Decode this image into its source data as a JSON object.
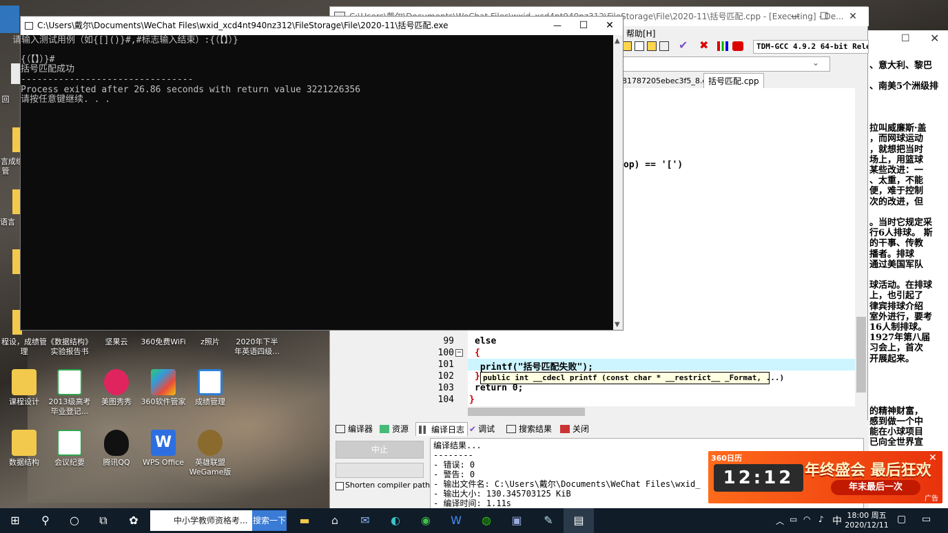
{
  "console": {
    "title": "C:\\Users\\戴尔\\Documents\\WeChat Files\\wxid_xcd4nt940nz312\\FileStorage\\File\\2020-11\\括号匹配.exe",
    "lines": [
      "请输入测试用例（如{[]()}#,#标志输入结束）:{（【】）}",
      "",
      "{（【】）}#",
      "括号匹配成功",
      "--------------------------------",
      "Process exited after 26.86 seconds with return value 3221226356",
      "请按任意键继续. . ."
    ],
    "minimize": "—",
    "maximize": "☐",
    "close": "✕"
  },
  "devcpp": {
    "title": "C:\\Users\\戴尔\\Documents\\WeChat Files\\wxid_xcd4nt940nz312\\FileStorage\\File\\2020-11\\括号匹配.cpp - [Executing] - De...",
    "menu_help": "帮助[H]",
    "compiler": "TDM-GCC 4.9.2 64-bit Release",
    "tab_prev": "81787205ebec3f5_8.cpp",
    "tab_active": "括号匹配.cpp",
    "code_fragment": "op) == '[')",
    "lines": [
      {
        "n": "99",
        "code": "else"
      },
      {
        "n": "100",
        "code": "{"
      },
      {
        "n": "101",
        "code": " printf(\"括号匹配失败\");"
      },
      {
        "n": "102",
        "code": "}"
      },
      {
        "n": "103",
        "code": "return 0;"
      },
      {
        "n": "104",
        "code": "}"
      }
    ],
    "tooltip": "public int __cdecl printf (const char * __restrict__ _Format, ...)",
    "bottom_tabs": [
      "编译器",
      "资源",
      "编译日志",
      "调试",
      "搜索结果",
      "关闭"
    ],
    "stop_button": "中止",
    "shorten_paths": "Shorten compiler paths",
    "log": [
      "编译结果...",
      "--------",
      "- 错误: 0",
      "- 警告: 0",
      "- 输出文件名: C:\\Users\\戴尔\\Documents\\WeChat Files\\wxid_",
      "- 输出大小: 130.345703125 KiB",
      "- 编译时间: 1.11s"
    ]
  },
  "doc": {
    "lines": [
      "、意大利、黎巴",
      "",
      "、南美5个洲级排",
      "",
      "",
      "",
      "拉叫威廉斯·盖",
      "，而网球运动",
      "，就想把当时",
      "场上，用篮球",
      "某些改进：一",
      "、太重，不能",
      "便，难于控制",
      "次的改进，但",
      "",
      "。当时它规定采",
      "行6人排球。 斯",
      "的干事、传教",
      "播者。排球",
      "通过美国军队",
      "",
      "球活动。在排球",
      "上，也引起了",
      "律宾排球介绍",
      "室外进行，要考",
      "16人制排球。",
      "1927年第八届",
      "习会上，首次",
      "开展起来。",
      "",
      "",
      "",
      "",
      "的精神财富，",
      "感到做一个中",
      "能在小球项目",
      "已向全世界宣"
    ]
  },
  "desktop_icons": [
    {
      "label": "程设，成绩管理"
    },
    {
      "label": "《数据结构》实验报告书"
    },
    {
      "label": "坚果云"
    },
    {
      "label": "360免费WiFi"
    },
    {
      "label": "z照片"
    },
    {
      "label": "2020年下半年英语四级..."
    },
    {
      "label": "课程设计"
    },
    {
      "label": "2013级高考毕业登记..."
    },
    {
      "label": "美图秀秀"
    },
    {
      "label": "360软件管家"
    },
    {
      "label": "成绩管理"
    },
    {
      "label": "数据结构"
    },
    {
      "label": "会议纪要"
    },
    {
      "label": "腾讯QQ"
    },
    {
      "label": "WPS Office"
    },
    {
      "label": "英雄联盟WeGame版"
    }
  ],
  "left_edge_labels": [
    "C语言成绩管",
    "c语言",
    "回"
  ],
  "ad": {
    "brand": "360日历",
    "clock": "12:12",
    "headline": "年终盛会 最后狂欢",
    "sub": "年末最后一次",
    "tag": "广告"
  },
  "taskbar": {
    "search_text": "中小学教师资格考...",
    "search_button": "搜索一下",
    "time": "18:00 周五",
    "date": "2020/12/11",
    "ime": "中"
  },
  "colors": {
    "accent": "#3a7bd5",
    "console_bg": "#0c0c0c",
    "highlight_line": "#ccf5ff"
  }
}
